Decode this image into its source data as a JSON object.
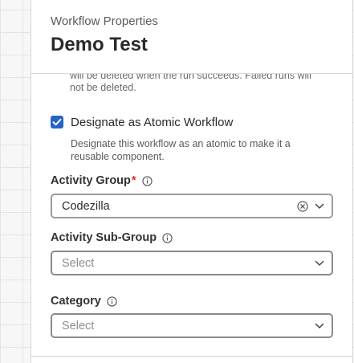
{
  "header": {
    "subtitle": "Workflow Properties",
    "title": "Demo Test"
  },
  "cleanup_note": {
    "line1": "will be deleted when the run succeeds. Failed runs will",
    "line2": "not be deleted."
  },
  "atomic": {
    "checked": true,
    "label": "Designate as Atomic Workflow",
    "help_line1": "Designate this workflow as an atomic to make it a",
    "help_line2": "reusable component."
  },
  "activity_group": {
    "label": "Activity Group",
    "required_mark": "*",
    "value": "Codezilla"
  },
  "activity_sub_group": {
    "label": "Activity Sub-Group",
    "placeholder": "Select"
  },
  "category": {
    "label": "Category",
    "placeholder": "Select"
  },
  "icons": {
    "info": "info-icon",
    "clear": "clear-icon",
    "chevron": "chevron-down-icon",
    "check": "checkmark-icon"
  },
  "colors": {
    "accent": "#2563c9",
    "required": "#d93025"
  }
}
